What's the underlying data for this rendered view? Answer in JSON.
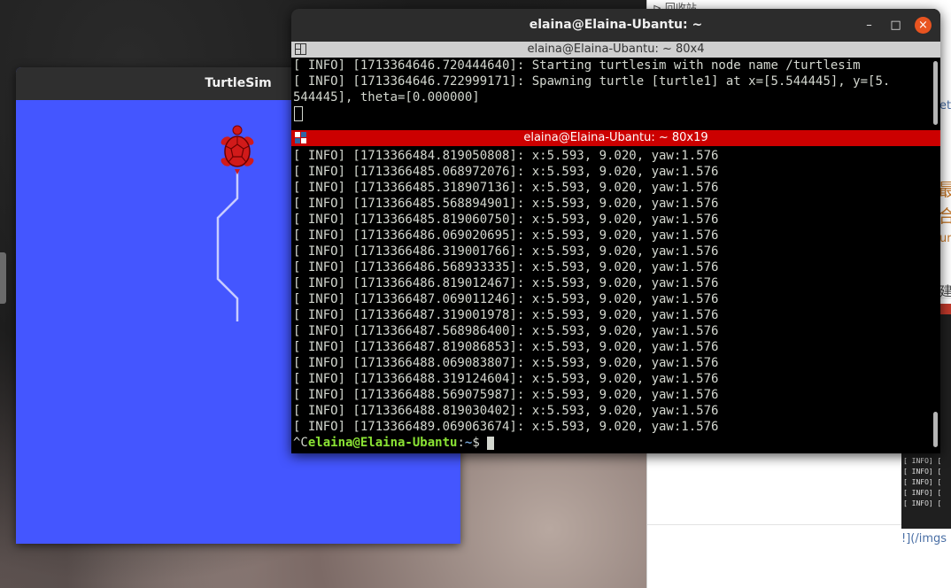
{
  "desktop": {
    "right_panel": {
      "recycle_label": "⊳ 回收站",
      "snippets": [
        "et",
        "最",
        "合",
        "ur",
        "建",
        "!](/imgs"
      ]
    },
    "mini_terminal_lines": [
      "[ INFO] [",
      "[ INFO] [",
      "[ INFO] [",
      "[ INFO] [",
      "[ INFO] ["
    ]
  },
  "turtlesim": {
    "title": "TurtleSim",
    "background_color": "#4456ff",
    "path_color": "#c8ccff",
    "turtle_color": "#d11a1a"
  },
  "terminal": {
    "title": "elaina@Elaina-Ubantu: ~",
    "buttons": {
      "minimize": "–",
      "maximize": "□",
      "close": "×"
    },
    "top_pane": {
      "header": "elaina@Elaina-Ubantu: ~ 80x4",
      "lines": [
        "[ INFO] [1713364646.720444640]: Starting turtlesim with node name /turtlesim",
        "[ INFO] [1713364646.722999171]: Spawning turtle [turtle1] at x=[5.544445], y=[5.",
        "544445], theta=[0.000000]"
      ]
    },
    "bottom_pane": {
      "header": "elaina@Elaina-Ubantu: ~ 80x19",
      "lines": [
        "[ INFO] [1713366484.819050808]: x:5.593, 9.020, yaw:1.576",
        "[ INFO] [1713366485.068972076]: x:5.593, 9.020, yaw:1.576",
        "[ INFO] [1713366485.318907136]: x:5.593, 9.020, yaw:1.576",
        "[ INFO] [1713366485.568894901]: x:5.593, 9.020, yaw:1.576",
        "[ INFO] [1713366485.819060750]: x:5.593, 9.020, yaw:1.576",
        "[ INFO] [1713366486.069020695]: x:5.593, 9.020, yaw:1.576",
        "[ INFO] [1713366486.319001766]: x:5.593, 9.020, yaw:1.576",
        "[ INFO] [1713366486.568933335]: x:5.593, 9.020, yaw:1.576",
        "[ INFO] [1713366486.819012467]: x:5.593, 9.020, yaw:1.576",
        "[ INFO] [1713366487.069011246]: x:5.593, 9.020, yaw:1.576",
        "[ INFO] [1713366487.319001978]: x:5.593, 9.020, yaw:1.576",
        "[ INFO] [1713366487.568986400]: x:5.593, 9.020, yaw:1.576",
        "[ INFO] [1713366487.819086853]: x:5.593, 9.020, yaw:1.576",
        "[ INFO] [1713366488.069083807]: x:5.593, 9.020, yaw:1.576",
        "[ INFO] [1713366488.319124604]: x:5.593, 9.020, yaw:1.576",
        "[ INFO] [1713366488.569075987]: x:5.593, 9.020, yaw:1.576",
        "[ INFO] [1713366488.819030402]: x:5.593, 9.020, yaw:1.576",
        "[ INFO] [1713366489.069063674]: x:5.593, 9.020, yaw:1.576"
      ],
      "prompt": {
        "prefix": "^C",
        "user_host": "elaina@Elaina-Ubantu",
        "separator": ":",
        "path": "~",
        "symbol": "$ "
      }
    }
  }
}
